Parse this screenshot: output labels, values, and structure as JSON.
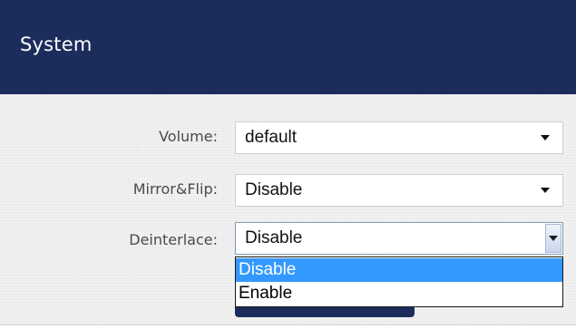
{
  "header": {
    "title": "System"
  },
  "form": {
    "rows": [
      {
        "label": "Volume:",
        "value": "default",
        "state": "closed"
      },
      {
        "label": "Mirror&Flip:",
        "value": "Disable",
        "state": "closed"
      },
      {
        "label": "Deinterlace:",
        "value": "Disable",
        "state": "open"
      }
    ]
  },
  "dropdown": {
    "options": [
      {
        "label": "Disable",
        "highlighted": true
      },
      {
        "label": "Enable",
        "highlighted": false
      }
    ]
  },
  "icons": {
    "closed_select_arrow": "chevron-down-icon",
    "open_select_button": "dropdown-button-icon"
  },
  "colors": {
    "header_bg": "#1c2d5b",
    "header_text": "#ffffff",
    "panel_bg": "#f2f2f2",
    "label_text": "#4a4a4a",
    "option_highlight": "#3399ff",
    "option_highlight_text": "#ffffff"
  }
}
